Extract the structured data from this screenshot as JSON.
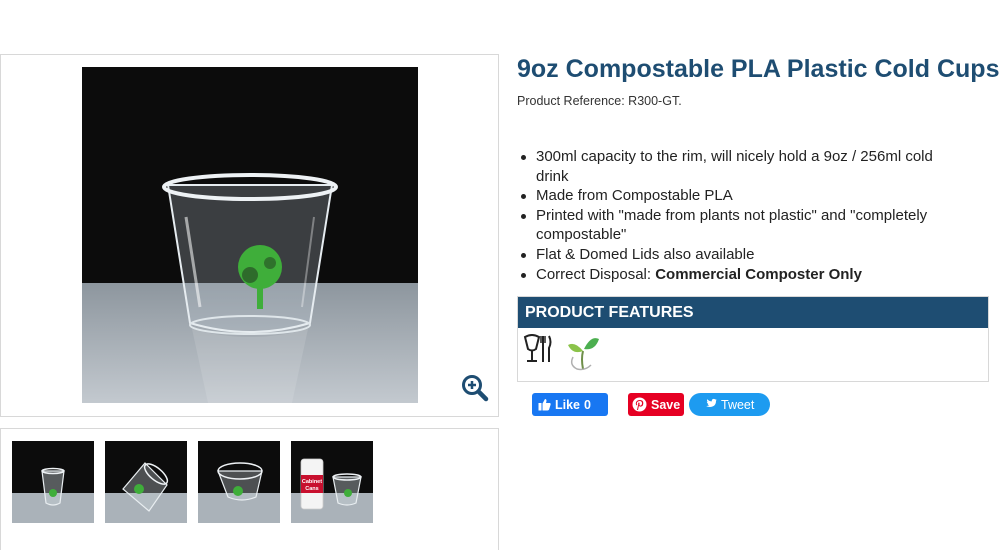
{
  "product": {
    "title": "9oz Compostable PLA Plastic Cold Cups",
    "reference": "Product Reference: R300-GT."
  },
  "bullets": {
    "b1": "300ml capacity to the rim, will nicely hold a 9oz / 256ml cold drink",
    "b2": "Made from Compostable PLA",
    "b3": "Printed with \"made from plants not plastic\" and \"completely compostable\"",
    "b4": "Flat & Domed Lids also available",
    "b5_prefix": "Correct Disposal: ",
    "b5_bold": "Commercial Composter Only"
  },
  "features": {
    "header": "PRODUCT FEATURES",
    "icons": [
      "food-safe-icon",
      "compostable-sprout-icon"
    ]
  },
  "gallery": {
    "zoom_icon": "zoom-in-icon",
    "thumbnail_count": 4,
    "thumb4_can_text": "Cabinet Cans"
  },
  "social": {
    "fb_label": "Like",
    "fb_count": "0",
    "pin_label": "Save",
    "tweet_label": "Tweet"
  },
  "colors": {
    "brand_blue": "#1e4d72",
    "facebook": "#1877f2",
    "pinterest": "#e60023",
    "twitter": "#1d9bf0"
  }
}
